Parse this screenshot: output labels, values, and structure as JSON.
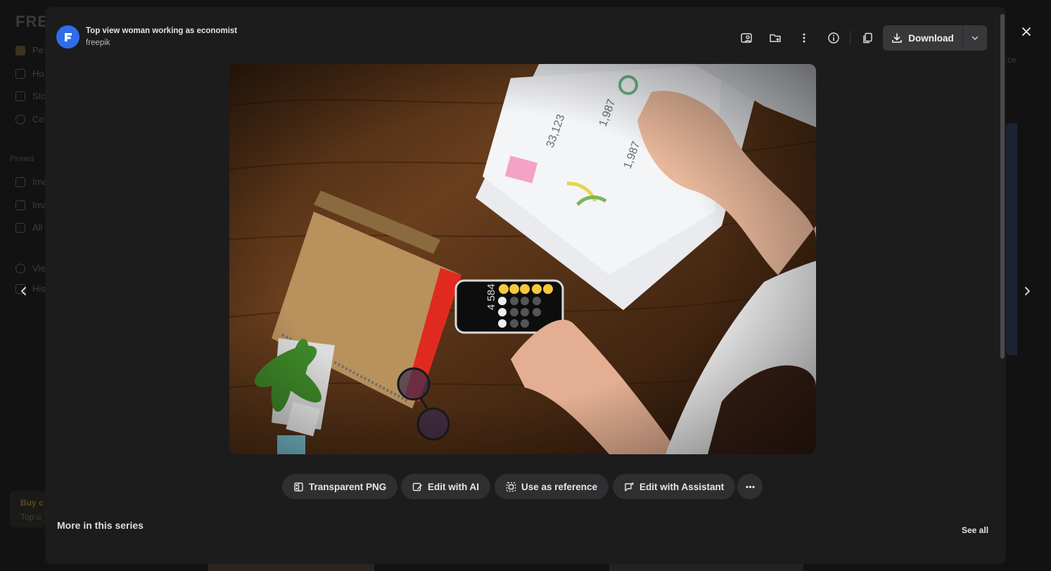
{
  "background_page": {
    "logo": "FRE",
    "sidebar": [
      {
        "label": "Pe",
        "icon": "pikaso-icon"
      },
      {
        "label": "Ho",
        "icon": "home-icon"
      },
      {
        "label": "Sto",
        "icon": "stock-icon"
      },
      {
        "label": "Co",
        "icon": "collections-icon"
      }
    ],
    "pinned_label": "Pinned",
    "pinned": [
      {
        "label": "Ima",
        "icon": "image-icon"
      },
      {
        "label": "Ima",
        "icon": "image-edit-icon"
      },
      {
        "label": "All",
        "icon": "grid-icon"
      }
    ],
    "extra": [
      {
        "label": "Vie",
        "icon": "video-icon"
      },
      {
        "label": "His",
        "icon": "history-icon"
      }
    ],
    "promo": {
      "line1": "Buy c",
      "line2": "Top u"
    },
    "right_text": "ce"
  },
  "modal": {
    "author": {
      "title": "Top view woman working as economist",
      "name": "freepik"
    },
    "toolbar": {
      "download_label": "Download"
    },
    "photo_alt": "Top view woman working as economist",
    "actions": [
      {
        "label": "Transparent PNG",
        "icon": "transparent-png-icon"
      },
      {
        "label": "Edit with AI",
        "icon": "edit-ai-icon"
      },
      {
        "label": "Use as reference",
        "icon": "reference-icon"
      },
      {
        "label": "Edit with Assistant",
        "icon": "assistant-icon"
      }
    ],
    "series": {
      "title": "More in this series",
      "see_all": "See all"
    }
  },
  "colors": {
    "avatar": "#2f6ee8",
    "modal_bg": "#1c1c1d",
    "pill_bg": "#2f2f31",
    "download_bg": "#38383a"
  }
}
